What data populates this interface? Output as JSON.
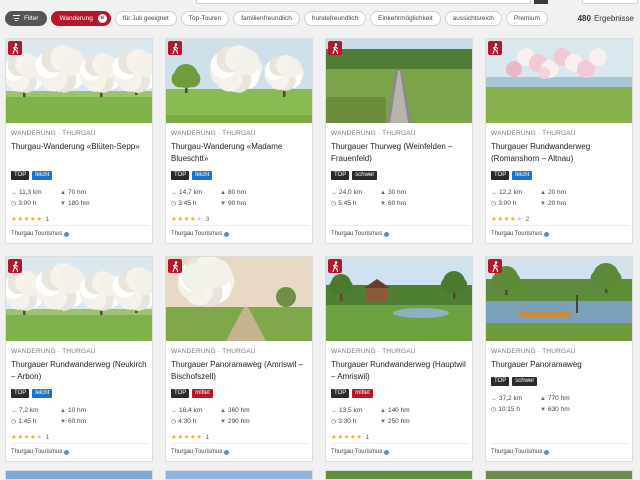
{
  "filters": {
    "filter_label": "Filter",
    "chips": [
      {
        "label": "Wanderung",
        "active": true
      },
      {
        "label": "für Juli geeignet",
        "active": false
      },
      {
        "label": "Top-Touren",
        "active": false
      },
      {
        "label": "familienfreundlich",
        "active": false
      },
      {
        "label": "hundefreundlich",
        "active": false
      },
      {
        "label": "Einkehrmöglichkeit",
        "active": false
      },
      {
        "label": "aussichtsreich",
        "active": false
      },
      {
        "label": "Premium",
        "active": false
      }
    ],
    "results_count": "480",
    "results_label": "Ergebnisse"
  },
  "cards": [
    {
      "meta": "WANDERUNG · THURGAU",
      "title": "Thurgau-Wanderung «Blüten-Sepp»",
      "tags": [
        "TOP",
        "leicht"
      ],
      "distance": "11,3 km",
      "ascent": "70 hm",
      "duration": "3:00 h",
      "descent": "180 hm",
      "stars": 5,
      "votes": "1",
      "source": "Thurgau Tourismus",
      "image": "blossom-orchard"
    },
    {
      "meta": "WANDERUNG · THURGAU",
      "title": "Thurgau-Wanderung «Madame Blueschtt»",
      "tags": [
        "TOP",
        "leicht"
      ],
      "distance": "14,7 km",
      "ascent": "80 hm",
      "duration": "3:45 h",
      "descent": "90 hm",
      "stars": 4,
      "votes": "3",
      "source": "Thurgau Tourismus",
      "image": "orchard-meadow"
    },
    {
      "meta": "WANDERUNG · THURGAU",
      "title": "Thurgauer Thurweg (Weinfelden – Frauenfeld)",
      "tags": [
        "TOP",
        "schwer"
      ],
      "distance": "24,0 km",
      "ascent": "30 hm",
      "duration": "5:45 h",
      "descent": "60 hm",
      "stars": 0,
      "votes": "",
      "source": "Thurgau Tourismus",
      "image": "footbridge"
    },
    {
      "meta": "WANDERUNG · THURGAU",
      "title": "Thurgauer Rundwanderweg (Romanshorn – Altnau)",
      "tags": [
        "TOP",
        "leicht"
      ],
      "distance": "12,2 km",
      "ascent": "20 hm",
      "duration": "3:00 h",
      "descent": "20 hm",
      "stars": 4,
      "votes": "2",
      "source": "Thurgau Tourismus",
      "image": "blossom-lake"
    },
    {
      "meta": "WANDERUNG · THURGAU",
      "title": "Thurgauer Rundwanderweg (Neukirch – Arbon)",
      "tags": [
        "TOP",
        "leicht"
      ],
      "distance": "7,2 km",
      "ascent": "10 hm",
      "duration": "1:45 h",
      "descent": "60 hm",
      "stars": 4,
      "votes": "1",
      "source": "Thurgau Tourismus",
      "image": "blossom-orchard"
    },
    {
      "meta": "WANDERUNG · THURGAU",
      "title": "Thurgauer Panoramaweg (Amriswil – Bischofszell)",
      "tags": [
        "TOP",
        "mittel"
      ],
      "distance": "16,4 km",
      "ascent": "360 hm",
      "duration": "4:30 h",
      "descent": "290 hm",
      "stars": 5,
      "votes": "1",
      "source": "Thurgau Tourismus",
      "image": "path-tree"
    },
    {
      "meta": "WANDERUNG · THURGAU",
      "title": "Thurgauer Rundwanderweg (Hauptwil – Amriswil)",
      "tags": [
        "TOP",
        "mittel"
      ],
      "distance": "13,5 km",
      "ascent": "140 hm",
      "duration": "3:30 h",
      "descent": "250 hm",
      "stars": 5,
      "votes": "1",
      "source": "Thurgau Tourismus",
      "image": "village-pond"
    },
    {
      "meta": "WANDERUNG · THURGAU",
      "title": "Thurgauer Panoramaweg",
      "tags": [
        "TOP",
        "schwer"
      ],
      "distance": "37,2 km",
      "ascent": "770 hm",
      "duration": "10:15 h",
      "descent": "630 hm",
      "stars": 0,
      "votes": "",
      "source": "Thurgau Tourismus",
      "image": "river-boat"
    }
  ]
}
